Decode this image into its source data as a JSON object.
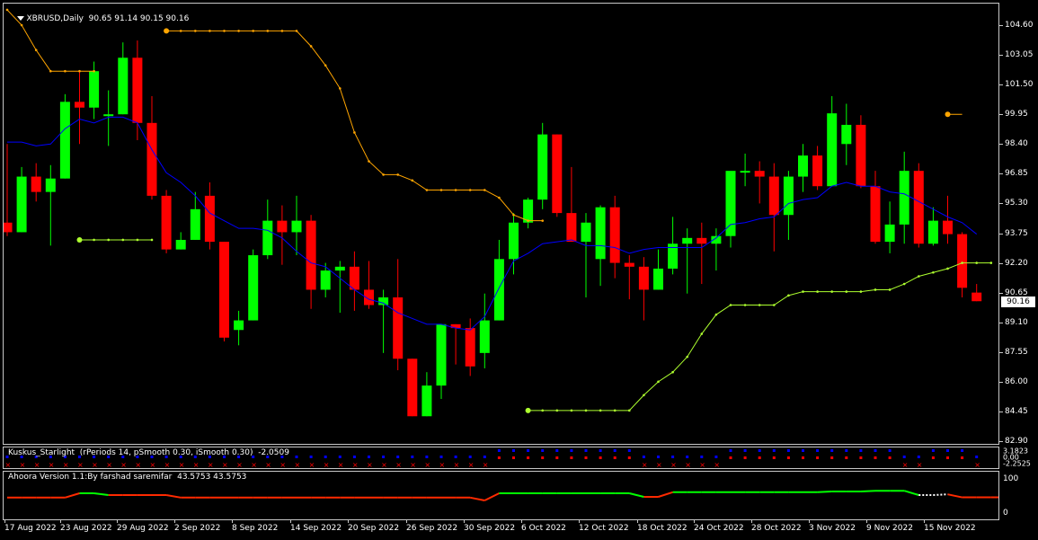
{
  "main": {
    "symbol_label": "XBRUSD,Daily",
    "ohlc_label": "90.65 91.14 90.15 90.16",
    "last_price": "90.16"
  },
  "colors": {
    "background": "#000000",
    "bull": "#00ff00",
    "bear": "#ff0000",
    "ma": "#0000ff",
    "trail_upper": "#ffa500",
    "trail_lower": "#adff2f",
    "ahoora_up": "#00ff00",
    "ahoora_down": "#ff2a00",
    "kuskus_blue": "#0000ff",
    "kuskus_red": "#ff0000"
  },
  "price_axis": [
    "104.60",
    "103.05",
    "101.50",
    "99.95",
    "98.40",
    "96.85",
    "95.30",
    "93.75",
    "92.20",
    "90.65",
    "89.10",
    "87.55",
    "86.00",
    "84.45",
    "82.90"
  ],
  "date_axis": [
    "17 Aug 2022",
    "23 Aug 2022",
    "29 Aug 2022",
    "2 Sep 2022",
    "8 Sep 2022",
    "14 Sep 2022",
    "20 Sep 2022",
    "26 Sep 2022",
    "30 Sep 2022",
    "6 Oct 2022",
    "12 Oct 2022",
    "18 Oct 2022",
    "24 Oct 2022",
    "28 Oct 2022",
    "3 Nov 2022",
    "9 Nov 2022",
    "15 Nov 2022"
  ],
  "kuskus": {
    "label": "Kuskus_Starlight  (rPeriods 14, pSmooth 0.30, iSmooth 0.30)  -2.0509",
    "axis": [
      "3.1823",
      "0.00",
      "-2.2525"
    ]
  },
  "ahoora": {
    "label": "Ahoora Version 1.1:By farshad saremifar  43.5753 43.5753",
    "axis": [
      "100",
      "0"
    ]
  },
  "chart_data": {
    "type": "candlestick",
    "symbol": "XBRUSD",
    "timeframe": "Daily",
    "ylim": [
      82.9,
      105.4
    ],
    "x_labels": [
      "17 Aug 2022",
      "23 Aug 2022",
      "29 Aug 2022",
      "2 Sep 2022",
      "8 Sep 2022",
      "14 Sep 2022",
      "20 Sep 2022",
      "26 Sep 2022",
      "30 Sep 2022",
      "6 Oct 2022",
      "12 Oct 2022",
      "18 Oct 2022",
      "24 Oct 2022",
      "28 Oct 2022",
      "3 Nov 2022",
      "9 Nov 2022",
      "15 Nov 2022"
    ],
    "candles": [
      [
        94.3,
        98.4,
        93.6,
        93.8
      ],
      [
        93.8,
        97.2,
        93.8,
        96.7
      ],
      [
        96.7,
        97.4,
        95.4,
        95.9
      ],
      [
        95.9,
        97.3,
        93.1,
        96.6
      ],
      [
        96.6,
        101.0,
        96.6,
        100.6
      ],
      [
        100.6,
        102.2,
        98.4,
        100.3
      ],
      [
        100.3,
        102.7,
        99.7,
        102.2
      ],
      [
        99.95,
        101.2,
        98.3,
        99.95
      ],
      [
        99.95,
        103.7,
        99.95,
        102.9
      ],
      [
        102.9,
        103.8,
        98.6,
        99.5
      ],
      [
        99.5,
        100.9,
        95.5,
        95.7
      ],
      [
        95.7,
        96.0,
        92.7,
        92.9
      ],
      [
        92.9,
        93.8,
        92.9,
        93.4
      ],
      [
        93.4,
        95.9,
        93.4,
        95.0
      ],
      [
        95.7,
        96.4,
        92.9,
        93.3
      ],
      [
        93.3,
        93.3,
        88.1,
        88.3
      ],
      [
        88.7,
        89.7,
        87.9,
        89.2
      ],
      [
        89.2,
        92.9,
        89.2,
        92.6
      ],
      [
        92.6,
        95.5,
        92.4,
        94.4
      ],
      [
        94.4,
        95.2,
        92.1,
        93.8
      ],
      [
        93.8,
        95.7,
        92.6,
        94.4
      ],
      [
        94.4,
        94.7,
        89.8,
        90.8
      ],
      [
        90.8,
        92.2,
        90.4,
        91.8
      ],
      [
        91.8,
        92.3,
        89.6,
        92.0
      ],
      [
        92.0,
        92.8,
        89.7,
        90.8
      ],
      [
        90.8,
        92.3,
        89.8,
        90.0
      ],
      [
        90.0,
        90.8,
        87.5,
        90.4
      ],
      [
        90.4,
        92.4,
        86.6,
        87.2
      ],
      [
        87.2,
        87.2,
        84.2,
        84.2
      ],
      [
        84.2,
        86.5,
        84.2,
        85.8
      ],
      [
        85.8,
        88.8,
        85.1,
        89.0
      ],
      [
        89.0,
        89.0,
        86.9,
        88.8
      ],
      [
        88.8,
        89.3,
        86.3,
        86.8
      ],
      [
        87.5,
        90.6,
        86.7,
        89.2
      ],
      [
        89.2,
        93.4,
        89.2,
        92.4
      ],
      [
        92.4,
        94.8,
        91.6,
        94.3
      ],
      [
        94.3,
        95.6,
        94.0,
        95.5
      ],
      [
        95.5,
        99.5,
        95.0,
        98.9
      ],
      [
        98.9,
        98.9,
        94.6,
        94.8
      ],
      [
        94.8,
        97.2,
        93.4,
        93.3
      ],
      [
        93.3,
        94.8,
        90.4,
        94.3
      ],
      [
        92.4,
        95.2,
        91.0,
        95.1
      ],
      [
        95.1,
        95.7,
        91.4,
        92.2
      ],
      [
        92.2,
        92.6,
        90.3,
        92.0
      ],
      [
        92.0,
        92.5,
        89.2,
        90.8
      ],
      [
        90.8,
        92.9,
        90.8,
        91.9
      ],
      [
        91.9,
        94.6,
        91.6,
        93.2
      ],
      [
        93.2,
        94.0,
        90.6,
        93.5
      ],
      [
        93.5,
        94.3,
        91.1,
        93.2
      ],
      [
        93.2,
        94.0,
        91.8,
        93.6
      ],
      [
        93.6,
        96.9,
        93.0,
        97.0
      ],
      [
        97.0,
        97.9,
        96.2,
        97.0
      ],
      [
        97.0,
        97.5,
        95.3,
        96.7
      ],
      [
        96.7,
        97.4,
        92.8,
        94.7
      ],
      [
        94.7,
        97.0,
        93.4,
        96.7
      ],
      [
        96.7,
        98.4,
        95.9,
        97.8
      ],
      [
        97.8,
        98.3,
        96.0,
        96.2
      ],
      [
        96.2,
        100.9,
        96.2,
        100.0
      ],
      [
        98.4,
        100.5,
        97.3,
        99.4
      ],
      [
        99.4,
        99.9,
        96.1,
        96.2
      ],
      [
        96.2,
        97.0,
        93.2,
        93.3
      ],
      [
        93.3,
        95.4,
        92.7,
        94.2
      ],
      [
        94.2,
        98.0,
        93.2,
        97.0
      ],
      [
        97.0,
        97.4,
        93.0,
        93.2
      ],
      [
        93.2,
        95.1,
        93.1,
        94.4
      ],
      [
        94.4,
        95.7,
        93.2,
        93.7
      ],
      [
        93.7,
        93.8,
        90.4,
        90.9
      ],
      [
        90.65,
        91.1,
        90.2,
        90.2
      ]
    ],
    "ma_line": [
      98.5,
      98.5,
      98.3,
      98.4,
      99.2,
      99.7,
      99.5,
      99.8,
      99.8,
      99.5,
      98.1,
      96.9,
      96.4,
      95.7,
      94.8,
      94.4,
      94.0,
      94.0,
      93.9,
      93.5,
      92.8,
      92.2,
      92.0,
      91.4,
      90.8,
      90.3,
      90.1,
      89.6,
      89.3,
      89.0,
      89.0,
      88.8,
      88.7,
      89.4,
      90.9,
      92.3,
      92.7,
      93.2,
      93.3,
      93.4,
      93.1,
      93.1,
      93.0,
      92.7,
      92.9,
      93.0,
      93.0,
      93.0,
      93.0,
      93.5,
      94.2,
      94.3,
      94.5,
      94.6,
      95.3,
      95.5,
      95.6,
      96.2,
      96.4,
      96.2,
      96.2,
      95.9,
      95.8,
      95.4,
      95.0,
      94.6,
      94.3,
      93.7
    ],
    "trail_upper": [
      105.4,
      104.6,
      103.3,
      102.2,
      102.2,
      102.2,
      102.2,
      null,
      null,
      null,
      null,
      104.3,
      104.3,
      104.3,
      104.3,
      104.3,
      104.3,
      104.3,
      104.3,
      104.3,
      104.3,
      103.5,
      102.5,
      101.3,
      99.0,
      97.5,
      96.8,
      96.8,
      96.5,
      96.0,
      96.0,
      96.0,
      96.0,
      96.0,
      95.6,
      94.7,
      94.4,
      94.4
    ],
    "trail_lower": [
      null,
      null,
      null,
      null,
      null,
      93.4,
      93.4,
      93.4,
      93.4,
      93.4,
      93.4,
      null,
      null,
      null,
      null,
      null,
      null,
      null,
      null,
      null,
      null,
      null,
      null,
      null,
      null,
      null,
      null,
      null,
      null,
      null,
      null,
      null,
      null,
      null,
      null,
      null,
      84.5,
      84.5,
      84.5,
      84.5,
      84.5,
      84.5,
      84.5,
      84.5,
      85.3,
      86.0,
      86.5,
      87.3,
      88.5,
      89.5,
      90.0,
      90.0,
      90.0,
      90.0,
      90.5,
      90.7,
      90.7,
      90.7,
      90.7,
      90.7,
      90.8,
      90.8,
      91.1,
      91.5,
      91.7,
      91.9,
      92.2,
      92.2,
      92.2
    ],
    "trail_upper_tail": [
      99.95,
      99.95,
      99.95
    ],
    "kuskus_signal": [
      -1,
      -1,
      -1,
      -1,
      -1,
      -1,
      -1,
      -1,
      -1,
      -1,
      -1,
      -1,
      -1,
      -1,
      -1,
      -1,
      -1,
      -1,
      -1,
      -1,
      -1,
      -1,
      -1,
      -1,
      -1,
      -1,
      -1,
      -1,
      -1,
      -1,
      -1,
      -1,
      -1,
      -1,
      1,
      1,
      1,
      1,
      1,
      1,
      1,
      1,
      1,
      1,
      -1,
      -1,
      -1,
      -1,
      -1,
      -1,
      1,
      1,
      1,
      1,
      1,
      1,
      1,
      1,
      1,
      1,
      1,
      1,
      -1,
      -1,
      1,
      1,
      1,
      -1
    ],
    "ahoora_values": [
      43,
      43,
      43,
      43,
      43,
      55,
      55,
      50,
      50,
      50,
      50,
      50,
      43,
      43,
      43,
      43,
      43,
      43,
      43,
      43,
      43,
      43,
      43,
      43,
      43,
      43,
      43,
      43,
      43,
      43,
      43,
      43,
      43,
      35,
      55,
      55,
      55,
      55,
      55,
      55,
      55,
      55,
      55,
      55,
      45,
      45,
      58,
      58,
      58,
      58,
      58,
      58,
      58,
      58,
      58,
      58,
      58,
      60,
      60,
      60,
      62,
      62,
      62,
      50,
      50,
      52,
      43.6,
      43.6,
      43.6,
      43.6
    ],
    "ahoora_trend": [
      -1,
      -1,
      -1,
      -1,
      -1,
      1,
      1,
      -1,
      -1,
      -1,
      -1,
      -1,
      -1,
      -1,
      -1,
      -1,
      -1,
      -1,
      -1,
      -1,
      -1,
      -1,
      -1,
      -1,
      -1,
      -1,
      -1,
      -1,
      -1,
      -1,
      -1,
      -1,
      -1,
      -1,
      1,
      1,
      1,
      1,
      1,
      1,
      1,
      1,
      1,
      1,
      -1,
      -1,
      1,
      1,
      1,
      1,
      1,
      1,
      1,
      1,
      1,
      1,
      1,
      1,
      1,
      1,
      1,
      1,
      1,
      0,
      0,
      -1,
      -1,
      -1,
      -1,
      -1
    ]
  }
}
